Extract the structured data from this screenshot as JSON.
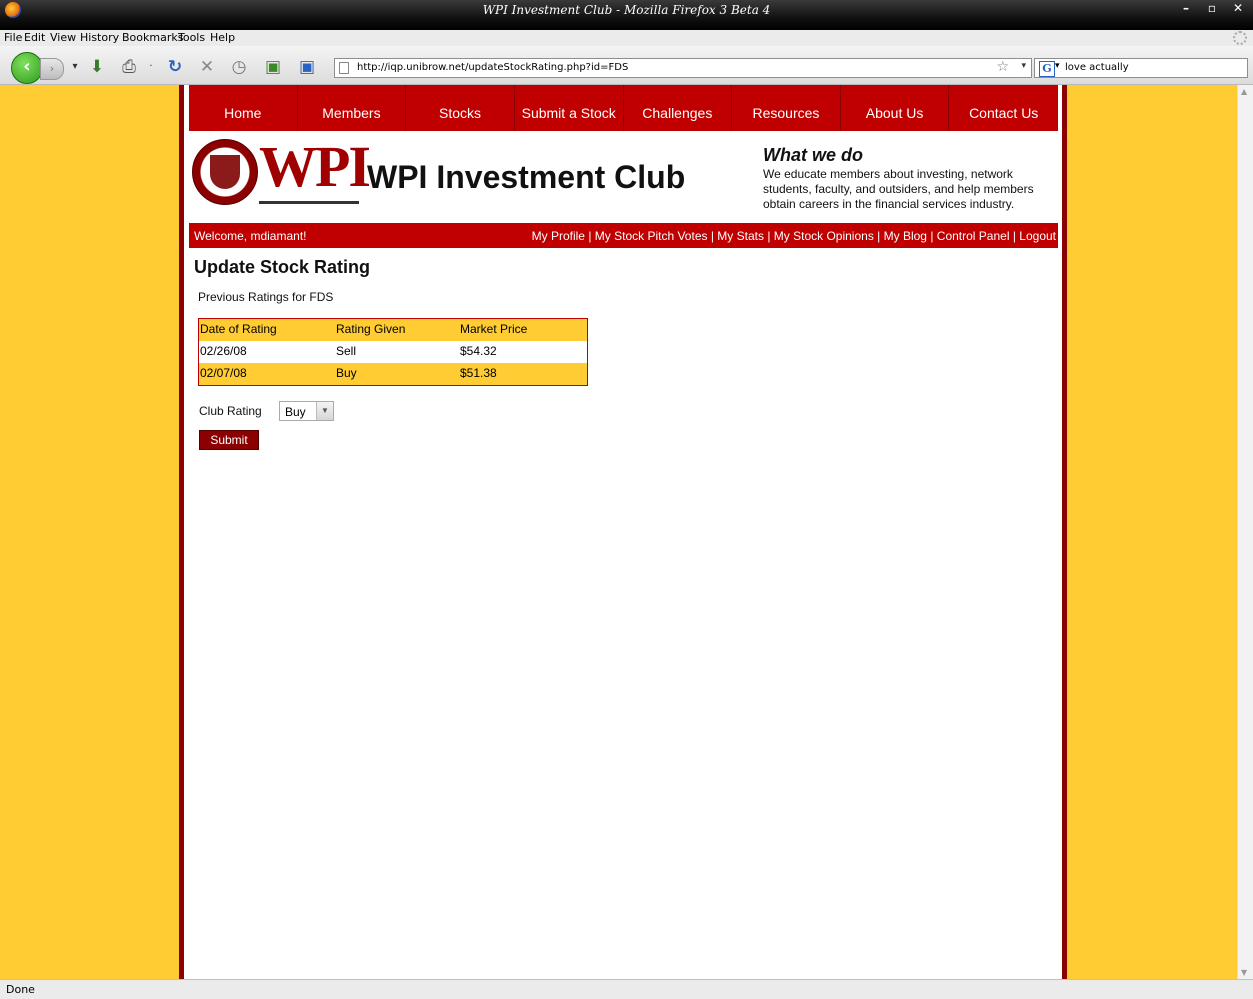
{
  "window": {
    "title": "WPI Investment Club - Mozilla Firefox 3 Beta 4",
    "controls": [
      "minimize",
      "maximize",
      "close"
    ]
  },
  "menu": [
    "File",
    "Edit",
    "View",
    "History",
    "Bookmarks",
    "Tools",
    "Help"
  ],
  "toolbar": {
    "back_icon": "back-arrow-icon",
    "forward_icon": "forward-arrow-icon",
    "url": "http://iqp.unibrow.net/updateStockRating.php?id=FDS",
    "search_engine": "G",
    "search_term": "love actually"
  },
  "site": {
    "nav": [
      "Home",
      "Members",
      "Stocks",
      "Submit a Stock",
      "Challenges",
      "Resources",
      "About Us",
      "Contact Us"
    ],
    "logo_text": "WPI",
    "club_name": "WPI Investment Club",
    "what_we_do_heading": "What we do",
    "what_we_do_text": "We educate members about investing, network students, faculty, and outsiders, and help members obtain careers in the financial services industry.",
    "welcome": "Welcome, mdiamant!",
    "user_links": [
      "My Profile",
      "My Stock Pitch Votes",
      "My Stats",
      "My Stock Opinions",
      "My Blog",
      "Control Panel",
      "Logout"
    ],
    "link_separator": "|"
  },
  "page": {
    "heading": "Update Stock Rating",
    "previous_label": "Previous Ratings for FDS",
    "table": {
      "headers": [
        "Date of Rating",
        "Rating Given",
        "Market Price"
      ],
      "rows": [
        [
          "02/26/08",
          "Sell",
          "$54.32"
        ],
        [
          "02/07/08",
          "Buy",
          "$51.38"
        ]
      ]
    },
    "club_rating_label": "Club Rating",
    "club_rating_value": "Buy",
    "submit_label": "Submit"
  },
  "status": "Done",
  "colors": {
    "site_red": "#c00000",
    "dark_red": "#8b0000",
    "gold": "#ffcc33"
  }
}
